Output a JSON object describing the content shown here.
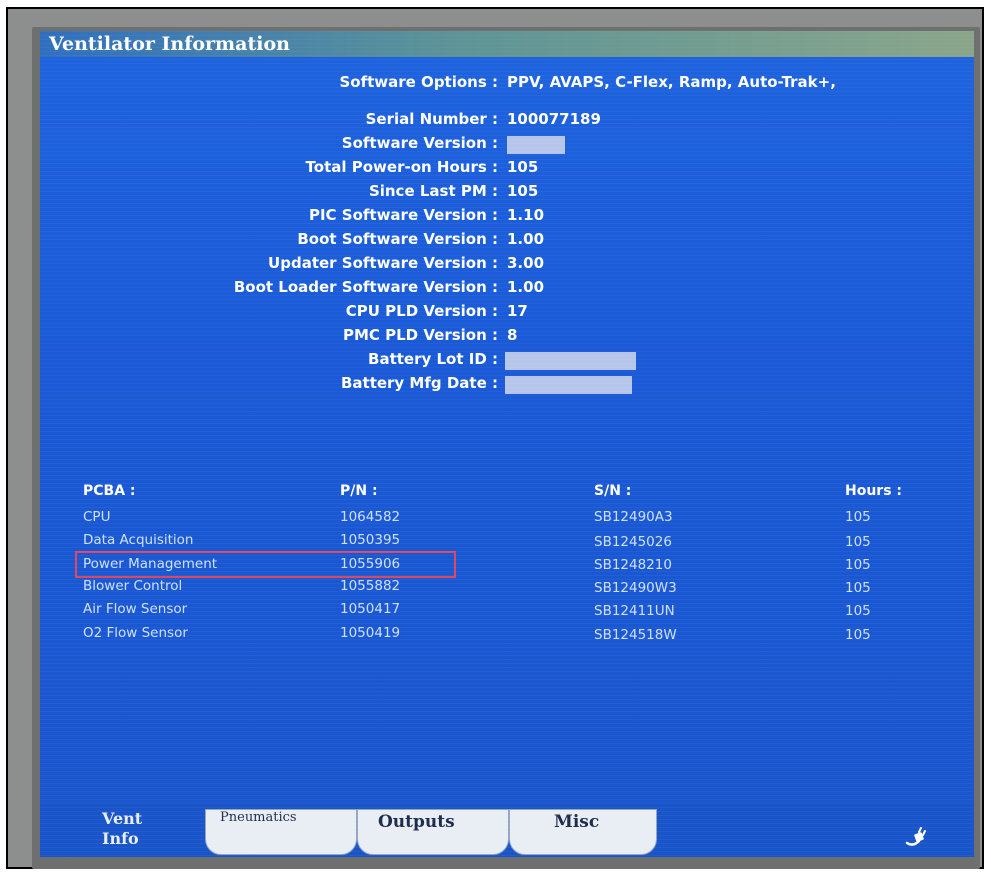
{
  "window": {
    "title": "Ventilator Information"
  },
  "software_options": {
    "label": "Software Options :",
    "value": "PPV, AVAPS, C-Flex, Ramp, Auto-Trak+,"
  },
  "info": [
    {
      "label": "Serial Number :",
      "value": "100077189"
    },
    {
      "label": "Software Version :",
      "value": ""
    },
    {
      "label": "Total Power-on Hours :",
      "value": "105"
    },
    {
      "label": "Since Last PM :",
      "value": "105"
    },
    {
      "label": "PIC Software Version :",
      "value": "1.10"
    },
    {
      "label": "Boot Software Version :",
      "value": "1.00"
    },
    {
      "label": "Updater Software Version :",
      "value": "3.00"
    },
    {
      "label": "Boot Loader Software Version :",
      "value": "1.00"
    },
    {
      "label": "CPU PLD Version :",
      "value": "17"
    },
    {
      "label": "PMC PLD Version :",
      "value": "8"
    },
    {
      "label": "Battery Lot ID :",
      "value": ""
    },
    {
      "label": "Battery Mfg Date :",
      "value": ""
    }
  ],
  "pcba": {
    "headers": {
      "pcba": "PCBA :",
      "pn": "P/N :",
      "sn": "S/N :",
      "hours": "Hours :"
    },
    "rows": [
      {
        "name": "CPU",
        "pn": "1064582",
        "sn": "SB12490A3",
        "hours": "105"
      },
      {
        "name": "Data Acquisition",
        "pn": "1050395",
        "sn": "SB1245026",
        "hours": "105"
      },
      {
        "name": "Power Management",
        "pn": "1055906",
        "sn": "SB1248210",
        "hours": "105"
      },
      {
        "name": "Blower Control",
        "pn": "1055882",
        "sn": "SB12490W3",
        "hours": "105"
      },
      {
        "name": "Air Flow Sensor",
        "pn": "1050417",
        "sn": "SB12411UN",
        "hours": "105"
      },
      {
        "name": "O2 Flow Sensor",
        "pn": "1050419",
        "sn": "SB124518W",
        "hours": "105"
      }
    ]
  },
  "tabs": {
    "vent_info": {
      "line1": "Vent",
      "line2": "Info"
    },
    "pneumatics": "Pneumatics",
    "outputs": "Outputs",
    "misc": "Misc"
  },
  "colors": {
    "screen_bg": "#1a5ad6",
    "highlight": "#e0465d",
    "tab_bg": "#e9eef4"
  },
  "icons": {
    "status": "power-plug-icon"
  }
}
